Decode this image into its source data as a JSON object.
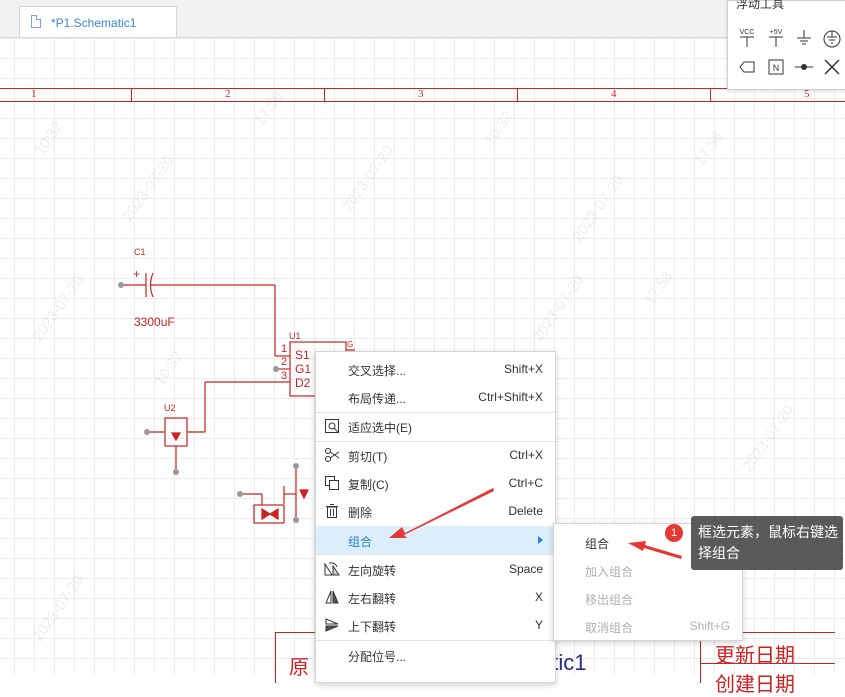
{
  "tab": {
    "label": "*P1.Schematic1"
  },
  "ruler": {
    "labels": [
      "1",
      "2",
      "3",
      "4",
      "5"
    ]
  },
  "float_tool": {
    "title": "浮动工具",
    "icons": [
      "vcc-icon",
      "plus-5v-icon",
      "ground-icon",
      "earth-ground-icon",
      "net-port-icon",
      "net-label-icon",
      "junction-icon",
      "no-connect-icon"
    ],
    "vcc_label": "VCC",
    "plus5v_label": "+5V",
    "netlabel_label": "N"
  },
  "schematic": {
    "c1_ref": "C1",
    "c1_value": "3300uF",
    "u1_ref": "U1",
    "u1_pins": [
      "1",
      "2",
      "3"
    ],
    "u1_pin_names": [
      "S1",
      "G1",
      "D2"
    ],
    "u1_pin_right": "G",
    "u2_ref": "U2",
    "color": "#cc2222"
  },
  "watermarks": [
    "10:32",
    "2023-07-20",
    "17:58",
    "2023-07-20",
    "10:32",
    "2023-07-20",
    "17:58",
    "2023-07-20",
    "10:32",
    "2023-07-20",
    "17:58",
    "2023-07-20",
    "10:32",
    "2023-07-20"
  ],
  "context_menu": {
    "items": [
      {
        "label": "交叉选择...",
        "shortcut": "Shift+X",
        "icon": ""
      },
      {
        "label": "布局传递...",
        "shortcut": "Ctrl+Shift+X",
        "icon": ""
      },
      {
        "label": "适应选中(E)",
        "shortcut": "",
        "icon": "zoom-fit-icon"
      },
      {
        "label": "剪切(T)",
        "shortcut": "Ctrl+X",
        "icon": "scissors-icon"
      },
      {
        "label": "复制(C)",
        "shortcut": "Ctrl+C",
        "icon": "copy-icon"
      },
      {
        "label": "删除",
        "shortcut": "Delete",
        "icon": "trash-icon"
      },
      {
        "label": "组合",
        "shortcut": "",
        "icon": ""
      },
      {
        "label": "左向旋转",
        "shortcut": "Space",
        "icon": "rotate-left-icon"
      },
      {
        "label": "左右翻转",
        "shortcut": "X",
        "icon": "flip-horizontal-icon"
      },
      {
        "label": "上下翻转",
        "shortcut": "Y",
        "icon": "flip-vertical-icon"
      },
      {
        "label": "分配位号...",
        "shortcut": "",
        "icon": ""
      }
    ]
  },
  "submenu": {
    "items": [
      {
        "label": "组合",
        "shortcut": "",
        "enabled": true
      },
      {
        "label": "加入组合",
        "shortcut": "",
        "enabled": false
      },
      {
        "label": "移出组合",
        "shortcut": "",
        "enabled": false
      },
      {
        "label": "取消组合",
        "shortcut": "Shift+G",
        "enabled": false
      }
    ]
  },
  "annotation": {
    "badge": "1",
    "tooltip": "框选元素，鼠标右键选择组合",
    "arrow_color": "#e53935"
  },
  "title_block": {
    "left_text": "原",
    "center_text": "atic1",
    "right_top": "更新日期",
    "right_bottom": "创建日期"
  }
}
